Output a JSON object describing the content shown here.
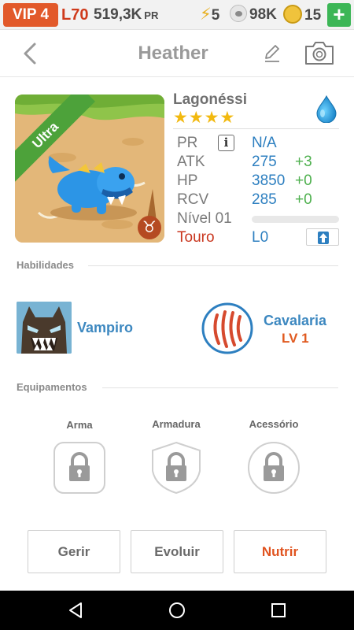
{
  "status_bar": {
    "vip": "VIP 4",
    "level": "L70",
    "pr_amount": "519,3K",
    "pr_unit": "PR",
    "energy": "5",
    "paws": "98K",
    "coins": "15",
    "add_label": "+"
  },
  "header": {
    "title": "Heather",
    "icons": [
      "chevron-left-icon",
      "pencil-icon",
      "camera-icon"
    ]
  },
  "creature": {
    "badge": "Ultra",
    "name": "Lagonéssi",
    "stars": "★★★★",
    "star_count": 4,
    "zodiac_glyph": "♉",
    "element_icon": "water-drop-icon",
    "stats": {
      "pr_label": "PR",
      "pr_info": "i",
      "pr_value": "N/A",
      "atk_label": "ATK",
      "atk_value": "275",
      "atk_bonus": "+3",
      "hp_label": "HP",
      "hp_value": "3850",
      "hp_bonus": "+0",
      "rcv_label": "RCV",
      "rcv_value": "285",
      "rcv_bonus": "+0",
      "level_label": "Nível 01",
      "xp_progress": 0.0,
      "sign_label": "Touro",
      "sign_level": "L0"
    }
  },
  "abilities": {
    "heading": "Habilidades",
    "passive_name": "Vampiro",
    "skill_name": "Cavalaria",
    "skill_level": "LV 1"
  },
  "equipment": {
    "heading": "Equipamentos",
    "slots": [
      {
        "label": "Arma"
      },
      {
        "label": "Armadura"
      },
      {
        "label": "Acessório"
      }
    ]
  },
  "buttons": {
    "manage": "Gerir",
    "evolve": "Evoluir",
    "feed": "Nutrir"
  },
  "colors": {
    "accent_blue": "#2d7fc0",
    "bonus_green": "#4eb04e",
    "orange": "#e0531f",
    "vip_orange": "#e2592a",
    "ultra_green": "#4da23a"
  }
}
